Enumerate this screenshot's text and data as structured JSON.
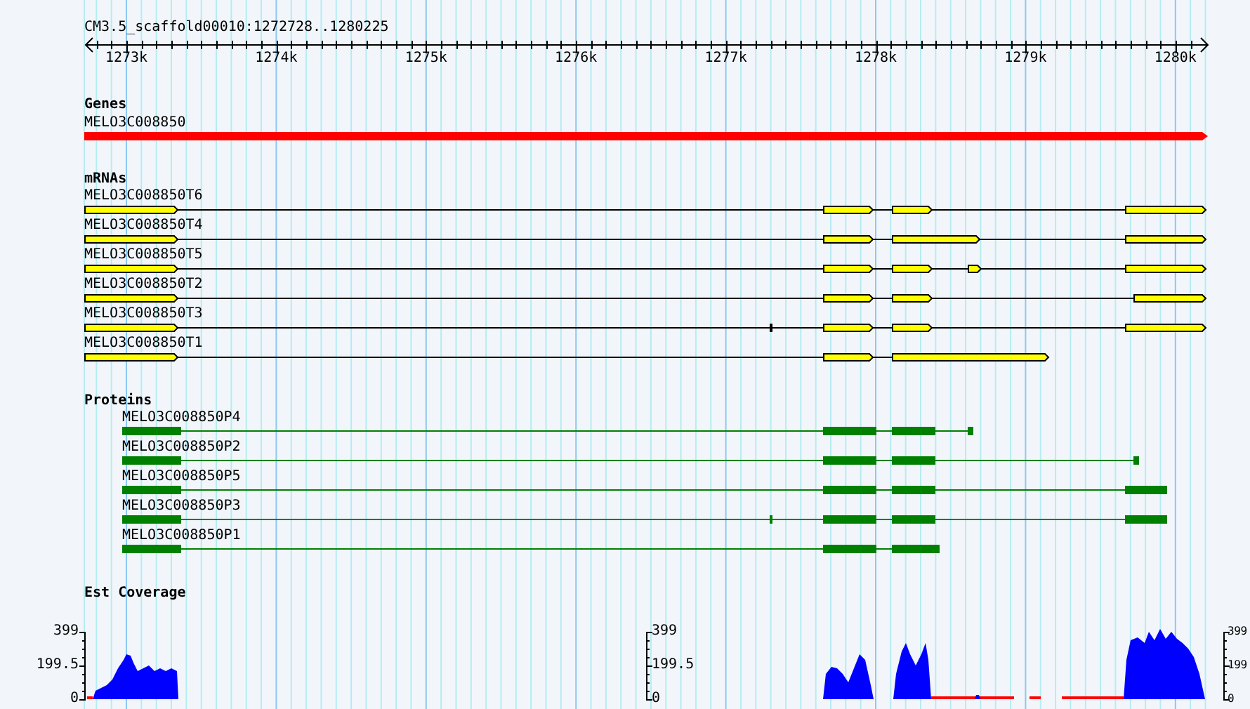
{
  "ruler": {
    "title": "CM3.5_scaffold00010:1272728..1280225",
    "ticks": [
      "1273k",
      "1274k",
      "1275k",
      "1276k",
      "1277k",
      "1278k",
      "1279k",
      "1280k"
    ]
  },
  "tracks": [
    {
      "kind": "genes",
      "title": "Genes",
      "features": [
        {
          "label": "MELO3C008850"
        }
      ]
    },
    {
      "kind": "mrnas",
      "title": "mRNAs",
      "features": [
        {
          "label": "MELO3C008850T6"
        },
        {
          "label": "MELO3C008850T4"
        },
        {
          "label": "MELO3C008850T5"
        },
        {
          "label": "MELO3C008850T2"
        },
        {
          "label": "MELO3C008850T3"
        },
        {
          "label": "MELO3C008850T1"
        }
      ]
    },
    {
      "kind": "proteins",
      "title": "Proteins",
      "features": [
        {
          "label": "MELO3C008850P4"
        },
        {
          "label": "MELO3C008850P2"
        },
        {
          "label": "MELO3C008850P5"
        },
        {
          "label": "MELO3C008850P3"
        },
        {
          "label": "MELO3C008850P1"
        }
      ]
    },
    {
      "kind": "coverage",
      "title": "Est Coverage",
      "axes": [
        {
          "labels": [
            "399",
            "199.5",
            "0"
          ]
        },
        {
          "labels": [
            "399",
            "199.5",
            "0"
          ]
        },
        {
          "labels": [
            "399",
            "199",
            "0"
          ]
        }
      ]
    }
  ]
}
